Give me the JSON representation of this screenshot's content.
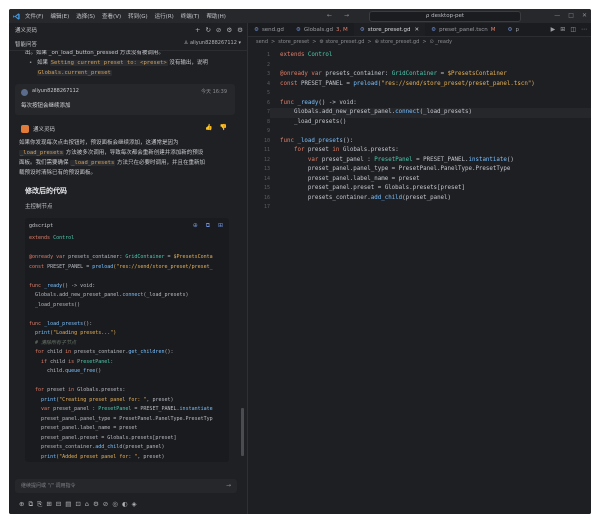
{
  "titlebar": {
    "menu": [
      "文件(F)",
      "编辑(E)",
      "选择(S)",
      "查看(V)",
      "转到(G)",
      "运行(R)",
      "终端(T)",
      "帮助(H)"
    ],
    "nav_back": "←",
    "nav_forward": "→",
    "search": "ρ desktop-pet",
    "win_buttons": [
      "—",
      "□",
      "✕"
    ]
  },
  "chat": {
    "header_title": "通义灵码",
    "header_icons": [
      "+",
      "↻",
      "⊘",
      "⚙",
      "⚙"
    ],
    "sub_title": "智能问答",
    "user_label": "♙ aliyun8288267112 ▾",
    "intro_line1": "出。如果 _on_load_button_pressed 方法没有被调用。",
    "bullet_prefix": "如果 ",
    "bullet_code1": "Setting current preset to: <preset>",
    "bullet_mid": " 没有输出，说明",
    "bullet_code2": "Globals.current_preset",
    "user_msg": {
      "name": "aliyun8288267112",
      "time": "今天 16:39",
      "text": "每次按钮会继续添加"
    },
    "ai": {
      "name": "通义灵码",
      "actions": [
        "👍",
        "👎"
      ],
      "line1_a": "如果你发现每次点击按钮时，预设面板会继续添加，这通常是因为",
      "line2_code": "_load_presets",
      "line2_b": " 方法被多次调用，导致每次都会重新创建并添加新的预设",
      "line3_a": "面板。我们需要确保 ",
      "line3_code": "_load_presets",
      "line3_b": " 方法只在必要时调用，并且在重新加",
      "line4": "载预设时清除已有的预设面板。",
      "heading": "修改后的代码",
      "subheading": "主控制节点"
    },
    "codeblock": {
      "lang": "gdscript",
      "icons": [
        "⊕",
        "⧉",
        "⊞"
      ],
      "lines": [
        [
          {
            "t": "extends ",
            "c": "k"
          },
          {
            "t": "Control",
            "c": "t"
          }
        ],
        [
          {
            "t": "",
            "c": ""
          }
        ],
        [
          {
            "t": "@onready var ",
            "c": "k"
          },
          {
            "t": "presets_container",
            "c": ""
          },
          {
            "t": ": ",
            "c": ""
          },
          {
            "t": "GridContainer",
            "c": "t"
          },
          {
            "t": " = ",
            "c": ""
          },
          {
            "t": "$PresetsConta",
            "c": "s"
          }
        ],
        [
          {
            "t": "const ",
            "c": "k"
          },
          {
            "t": "PRESET_PANEL = ",
            "c": ""
          },
          {
            "t": "preload",
            "c": "f"
          },
          {
            "t": "(\"res://send/store_preset/preset_",
            "c": "s"
          }
        ],
        [
          {
            "t": "",
            "c": ""
          }
        ],
        [
          {
            "t": "func ",
            "c": "k"
          },
          {
            "t": "_ready",
            "c": "f"
          },
          {
            "t": "() -> void:",
            "c": ""
          }
        ],
        [
          {
            "t": "  Globals.add_new_preset_panel.",
            "c": ""
          },
          {
            "t": "connect",
            "c": "f"
          },
          {
            "t": "(_load_presets)",
            "c": ""
          }
        ],
        [
          {
            "t": "  _load_presets()",
            "c": ""
          }
        ],
        [
          {
            "t": "",
            "c": ""
          }
        ],
        [
          {
            "t": "func ",
            "c": "k"
          },
          {
            "t": "_load_presets",
            "c": "f"
          },
          {
            "t": "():",
            "c": ""
          }
        ],
        [
          {
            "t": "  ",
            "c": ""
          },
          {
            "t": "print",
            "c": "f"
          },
          {
            "t": "(\"Loading presets...\")",
            "c": "s"
          }
        ],
        [
          {
            "t": "  # 清除所有子节点",
            "c": "c"
          }
        ],
        [
          {
            "t": "  for ",
            "c": "k"
          },
          {
            "t": "child ",
            "c": ""
          },
          {
            "t": "in ",
            "c": "k"
          },
          {
            "t": "presets_container.",
            "c": ""
          },
          {
            "t": "get_children",
            "c": "f"
          },
          {
            "t": "():",
            "c": ""
          }
        ],
        [
          {
            "t": "    if ",
            "c": "k"
          },
          {
            "t": "child ",
            "c": ""
          },
          {
            "t": "is ",
            "c": "k"
          },
          {
            "t": "PresetPanel:",
            "c": "t"
          }
        ],
        [
          {
            "t": "      child.",
            "c": ""
          },
          {
            "t": "queue_free",
            "c": "f"
          },
          {
            "t": "()",
            "c": ""
          }
        ],
        [
          {
            "t": "",
            "c": ""
          }
        ],
        [
          {
            "t": "  for ",
            "c": "k"
          },
          {
            "t": "preset ",
            "c": ""
          },
          {
            "t": "in ",
            "c": "k"
          },
          {
            "t": "Globals.presets:",
            "c": ""
          }
        ],
        [
          {
            "t": "    ",
            "c": ""
          },
          {
            "t": "print",
            "c": "f"
          },
          {
            "t": "(\"Creating preset panel for: \"",
            "c": "s"
          },
          {
            "t": ", preset)",
            "c": ""
          }
        ],
        [
          {
            "t": "    var ",
            "c": "k"
          },
          {
            "t": "preset_panel : ",
            "c": ""
          },
          {
            "t": "PresetPanel",
            "c": "t"
          },
          {
            "t": " = PRESET_PANEL.",
            "c": ""
          },
          {
            "t": "instantiate",
            "c": "f"
          }
        ],
        [
          {
            "t": "    preset_panel.panel_type = PresetPanel.PanelType.PresetTyp",
            "c": ""
          }
        ],
        [
          {
            "t": "    preset_panel.label_name = preset",
            "c": ""
          }
        ],
        [
          {
            "t": "    preset_panel.preset = Globals.presets[preset]",
            "c": ""
          }
        ],
        [
          {
            "t": "    presets_container.",
            "c": ""
          },
          {
            "t": "add_child",
            "c": "f"
          },
          {
            "t": "(preset_panel)",
            "c": ""
          }
        ],
        [
          {
            "t": "    ",
            "c": ""
          },
          {
            "t": "print",
            "c": "f"
          },
          {
            "t": "(\"Added preset panel for: \"",
            "c": "s"
          },
          {
            "t": ", preset)",
            "c": ""
          }
        ]
      ]
    },
    "input_placeholder": "继续提问或 \"/\" 调用指令",
    "input_send": "→",
    "tool_icons": [
      "⊕",
      "⧉",
      "⎘",
      "⊞",
      "⊟",
      "▤",
      "⊡",
      "⌂",
      "⚙",
      "⊘",
      "◎",
      "◐",
      "◈"
    ]
  },
  "editor": {
    "tabs": [
      {
        "icon": "⚙",
        "label": "send.gd",
        "active": false,
        "mod": ""
      },
      {
        "icon": "⚙",
        "label": "Globals.gd",
        "active": false,
        "mod": "3, M"
      },
      {
        "icon": "⚙",
        "label": "store_preset.gd",
        "active": true,
        "mod": ""
      },
      {
        "icon": "⚙",
        "label": "preset_panel.tscn",
        "active": false,
        "mod": "M"
      },
      {
        "icon": "⚙",
        "label": "p",
        "active": false,
        "mod": ""
      }
    ],
    "close_glyph": "✕",
    "tab_actions": [
      "▶",
      "⊞",
      "◫",
      "⋯"
    ],
    "breadcrumbs": [
      "send",
      ">",
      "store_preset",
      ">",
      "⚙ store_preset.gd",
      ">",
      "⊕ store_preset.gd",
      ">",
      "⊙ _ready"
    ],
    "lines": [
      [
        {
          "t": "extends ",
          "c": "k"
        },
        {
          "t": "Control",
          "c": "t"
        }
      ],
      [
        {
          "t": "",
          "c": ""
        }
      ],
      [
        {
          "t": "@onready var ",
          "c": "k"
        },
        {
          "t": "presets_container",
          "c": ""
        },
        {
          "t": ": ",
          "c": ""
        },
        {
          "t": "GridContainer",
          "c": "t"
        },
        {
          "t": " = ",
          "c": ""
        },
        {
          "t": "$PresetsContainer",
          "c": "s"
        }
      ],
      [
        {
          "t": "const ",
          "c": "k"
        },
        {
          "t": "PRESET_PANEL = ",
          "c": ""
        },
        {
          "t": "preload",
          "c": "f"
        },
        {
          "t": "(\"res://send/store_preset/preset_panel.tscn\")",
          "c": "s"
        }
      ],
      [
        {
          "t": "",
          "c": ""
        }
      ],
      [
        {
          "t": "func ",
          "c": "k"
        },
        {
          "t": "_ready",
          "c": "f"
        },
        {
          "t": "() -> void:",
          "c": ""
        }
      ],
      [
        {
          "t": "    Globals.add_new_preset_panel.",
          "c": ""
        },
        {
          "t": "connect",
          "c": "f"
        },
        {
          "t": "(_load_presets)",
          "c": ""
        }
      ],
      [
        {
          "t": "    _load_presets()",
          "c": ""
        }
      ],
      [
        {
          "t": "",
          "c": ""
        }
      ],
      [
        {
          "t": "func ",
          "c": "k"
        },
        {
          "t": "_load_presets",
          "c": "f"
        },
        {
          "t": "():",
          "c": ""
        }
      ],
      [
        {
          "t": "    for ",
          "c": "k"
        },
        {
          "t": "preset ",
          "c": ""
        },
        {
          "t": "in ",
          "c": "k"
        },
        {
          "t": "Globals.presets:",
          "c": ""
        }
      ],
      [
        {
          "t": "        var ",
          "c": "k"
        },
        {
          "t": "preset_panel : ",
          "c": ""
        },
        {
          "t": "PresetPanel",
          "c": "t"
        },
        {
          "t": " = PRESET_PANEL.",
          "c": ""
        },
        {
          "t": "instantiate",
          "c": "f"
        },
        {
          "t": "()",
          "c": ""
        }
      ],
      [
        {
          "t": "        preset_panel.panel_type = PresetPanel.PanelType.PresetType",
          "c": ""
        }
      ],
      [
        {
          "t": "        preset_panel.label_name = preset",
          "c": ""
        }
      ],
      [
        {
          "t": "        preset_panel.preset = Globals.presets[preset]",
          "c": ""
        }
      ],
      [
        {
          "t": "        presets_container.",
          "c": ""
        },
        {
          "t": "add_child",
          "c": "f"
        },
        {
          "t": "(preset_panel)",
          "c": ""
        }
      ],
      [
        {
          "t": "",
          "c": ""
        }
      ]
    ],
    "current_line": 7
  }
}
